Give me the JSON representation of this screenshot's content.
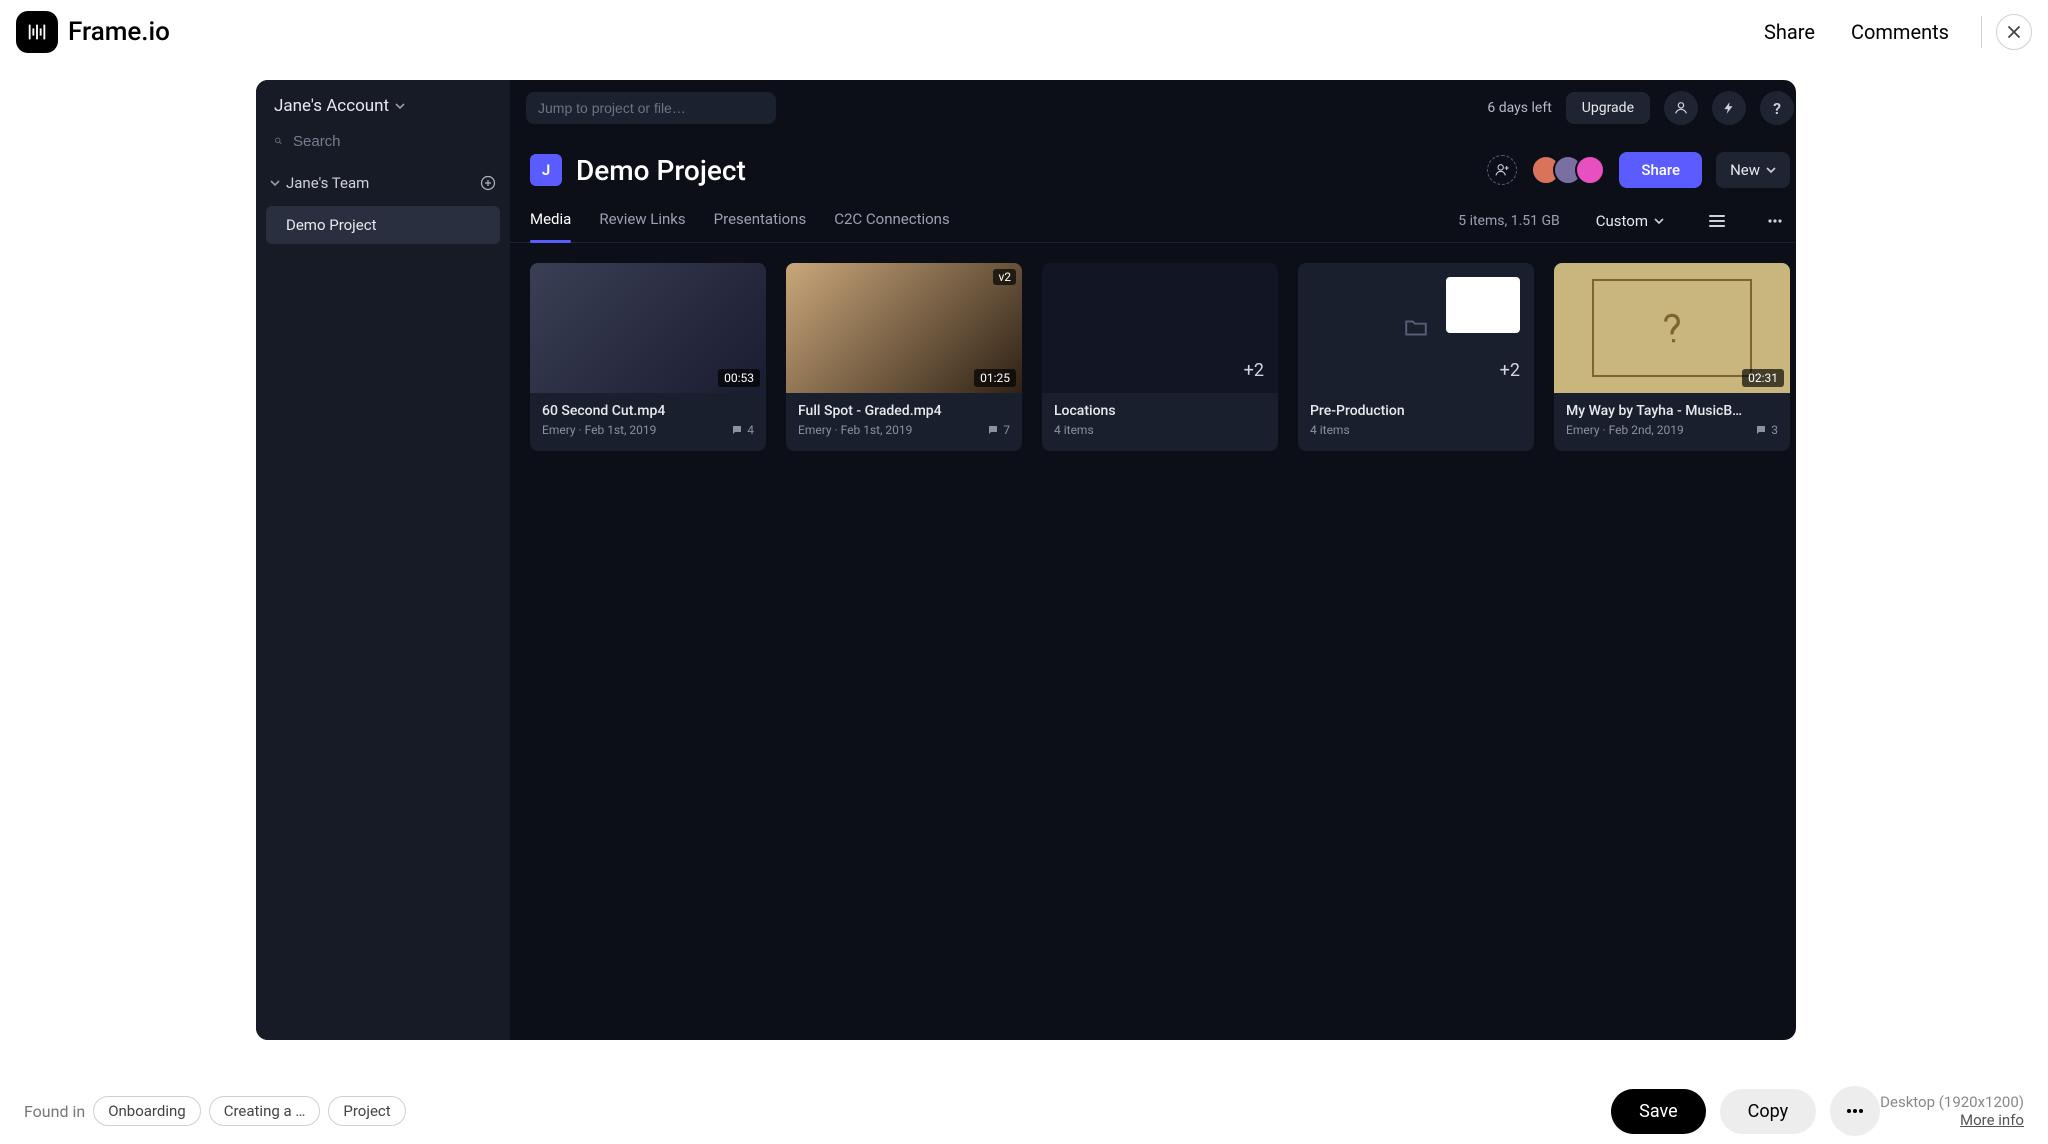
{
  "topbar": {
    "brand": "Frame.io",
    "share": "Share",
    "comments": "Comments"
  },
  "sidebar": {
    "account_label": "Jane's Account",
    "search_placeholder": "Search",
    "team_label": "Jane's Team",
    "project_label": "Demo Project"
  },
  "header": {
    "jump_placeholder": "Jump to project or file…",
    "trial_text": "6 days left",
    "upgrade_label": "Upgrade",
    "project_badge": "J",
    "project_title": "Demo Project",
    "share_label": "Share",
    "new_label": "New"
  },
  "tabs": {
    "items": [
      "Media",
      "Review Links",
      "Presentations",
      "C2C Connections"
    ],
    "stats": "5 items, 1.51 GB",
    "custom_label": "Custom"
  },
  "cards": [
    {
      "title": "60 Second Cut.mp4",
      "sub": "Emery · Feb 1st, 2019",
      "comments": "4",
      "duration": "00:53",
      "badge": ""
    },
    {
      "title": "Full Spot - Graded.mp4",
      "sub": "Emery · Feb 1st, 2019",
      "comments": "7",
      "duration": "01:25",
      "badge": "v2"
    },
    {
      "title": "Locations",
      "sub": "4 items",
      "comments": "",
      "duration": "",
      "badge": "+2"
    },
    {
      "title": "Pre-Production",
      "sub": "4 items",
      "comments": "",
      "duration": "",
      "badge": "+2"
    },
    {
      "title": "My Way by Tayha - MusicB…",
      "sub": "Emery · Feb 2nd, 2019",
      "comments": "3",
      "duration": "02:31",
      "badge": ""
    }
  ],
  "bottombar": {
    "found_in": "Found in",
    "tags": [
      "Onboarding",
      "Creating a …",
      "Project"
    ],
    "save": "Save",
    "copy": "Copy",
    "desktop": "Desktop (1920x1200)",
    "more_info": "More info"
  }
}
